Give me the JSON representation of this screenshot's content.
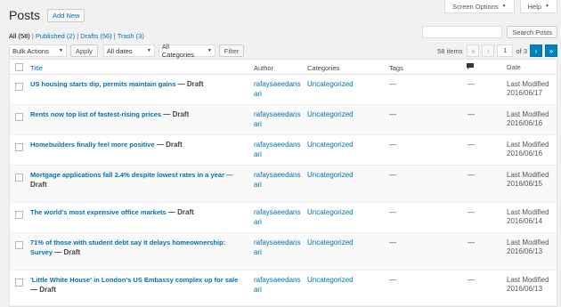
{
  "top": {
    "screen_options": "Screen Options",
    "help": "Help"
  },
  "header": {
    "title": "Posts",
    "add_new": "Add New"
  },
  "views": {
    "all": "All (58)",
    "published": "Published (2)",
    "drafts": "Drafts (56)",
    "trash": "Trash (3)",
    "sep": "|"
  },
  "search": {
    "button": "Search Posts"
  },
  "filters": {
    "bulk": "Bulk Actions",
    "apply": "Apply",
    "dates": "All dates",
    "categories": "All Categories",
    "filter": "Filter"
  },
  "pager": {
    "items": "58 items",
    "first": "«",
    "prev": "‹",
    "current": "1",
    "of": "of 3",
    "next": "›",
    "last": "»"
  },
  "columns": {
    "title": "Title",
    "author": "Author",
    "categories": "Categories",
    "tags": "Tags",
    "date": "Date"
  },
  "rows": [
    {
      "title": "US housing starts dip, permits maintain gains",
      "state": "— Draft",
      "author1": "rafaysaeedans",
      "author2": "ari",
      "category": "Uncategorized",
      "tags": "—",
      "comments": "—",
      "date_label": "Last Modified",
      "date": "2016/06/17"
    },
    {
      "title": "Rents now top list of fastest-rising prices",
      "state": "— Draft",
      "author1": "rafaysaeedans",
      "author2": "ari",
      "category": "Uncategorized",
      "tags": "—",
      "comments": "—",
      "date_label": "Last Modified",
      "date": "2016/06/16"
    },
    {
      "title": "Homebuilders finally feel more positive",
      "state": "— Draft",
      "author1": "rafaysaeedans",
      "author2": "ari",
      "category": "Uncategorized",
      "tags": "—",
      "comments": "—",
      "date_label": "Last Modified",
      "date": "2016/06/16"
    },
    {
      "title": "Mortgage applications fall 2.4% despite lowest rates in a year —",
      "state": "Draft",
      "author1": "rafaysaeedans",
      "author2": "ari",
      "category": "Uncategorized",
      "tags": "—",
      "comments": "—",
      "date_label": "Last Modified",
      "date": "2016/06/15"
    },
    {
      "title": "The world's most expensive office markets",
      "state": "— Draft",
      "author1": "rafaysaeedans",
      "author2": "ari",
      "category": "Uncategorized",
      "tags": "—",
      "comments": "—",
      "date_label": "Last Modified",
      "date": "2016/06/14"
    },
    {
      "title": "71% of those with student debt say it delays homeownership: Survey",
      "state": "— Draft",
      "author1": "rafaysaeedans",
      "author2": "ari",
      "category": "Uncategorized",
      "tags": "—",
      "comments": "—",
      "date_label": "Last Modified",
      "date": "2016/06/13"
    },
    {
      "title": "'Little White House' in London's US Embassy complex up for sale",
      "state": "— Draft",
      "author1": "rafaysaeedans",
      "author2": "ari",
      "category": "Uncategorized",
      "tags": "—",
      "comments": "—",
      "date_label": "Last Modified",
      "date": "2016/06/13"
    }
  ]
}
